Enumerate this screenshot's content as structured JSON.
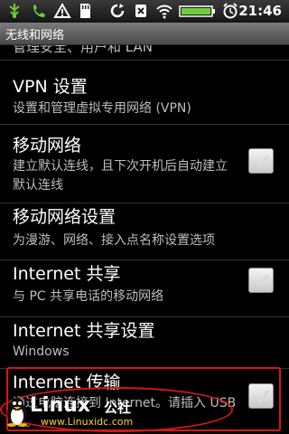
{
  "status_bar": {
    "icons": [
      "usb-icon",
      "phone-icon",
      "warning-icon",
      "sd-card-icon",
      "sync-icon",
      "no-sim-icon",
      "wifi-icon",
      "battery-icon",
      "alarm-icon"
    ],
    "time": "21:46"
  },
  "title_bar": {
    "title": "无线和网络"
  },
  "settings": {
    "partial_item": "管理安全、用户和 LAN",
    "items": [
      {
        "title": "VPN 设置",
        "summary": "设置和管理虚拟专用网络 (VPN)",
        "has_checkbox": false
      },
      {
        "title": "移动网络",
        "summary": "建立默认连线，且下次开机后自动建立默认连线",
        "has_checkbox": true,
        "checked": true
      },
      {
        "title": "移动网络设置",
        "summary": "为漫游、网络、接入点名称设置选项",
        "has_checkbox": false
      },
      {
        "title": "Internet 共享",
        "summary": "与 PC 共享电话的移动网络",
        "has_checkbox": true,
        "checked": true
      },
      {
        "title": "Internet 共享设置",
        "summary": "Windows",
        "has_checkbox": false
      },
      {
        "title": "Internet 传输",
        "summary": "通过电脑连接到 Internet。请插入 USB 线。",
        "has_checkbox": true,
        "checked": true
      }
    ]
  },
  "watermark": {
    "logo": "Linux",
    "cn": "公社",
    "url": "www.Linuxidc.com"
  },
  "colors": {
    "highlight": "#d51616",
    "summary_text": "#bdbdbd"
  }
}
